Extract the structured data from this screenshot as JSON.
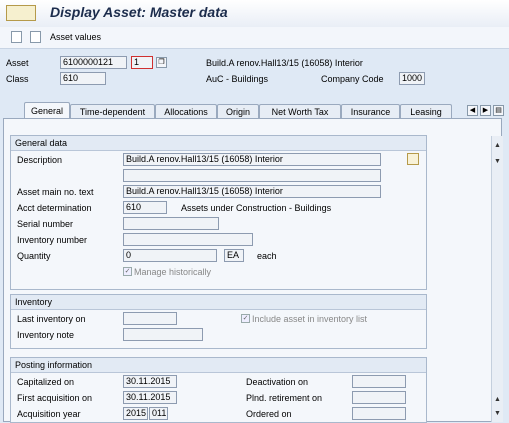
{
  "window": {
    "title": "Display Asset:  Master data"
  },
  "toolbar": {
    "asset_values_label": "Asset values"
  },
  "header": {
    "asset_label": "Asset",
    "asset_value": "6100000121",
    "sub_number": "1",
    "asset_desc": "Build.A renov.Hall13/15 (16058) Interior",
    "class_label": "Class",
    "class_value": "610",
    "class_desc": "AuC - Buildings",
    "company_code_label": "Company Code",
    "company_code_value": "1000"
  },
  "tabs": [
    "General",
    "Time-dependent",
    "Allocations",
    "Origin",
    "Net Worth Tax",
    "Insurance",
    "Leasing"
  ],
  "general_data": {
    "title": "General data",
    "description_label": "Description",
    "description_value": "Build.A renov.Hall13/15 (16058) Interior",
    "description_value2": "",
    "main_text_label": "Asset main no. text",
    "main_text_value": "Build.A renov.Hall13/15 (16058) Interior",
    "acct_det_label": "Acct determination",
    "acct_det_value": "610",
    "acct_det_desc": "Assets under Construction - Buildings",
    "serial_label": "Serial number",
    "inventory_number_label": "Inventory number",
    "quantity_label": "Quantity",
    "quantity_value": "0",
    "unit_value": "EA",
    "unit_desc": "each",
    "manage_hist_label": "Manage historically"
  },
  "inventory": {
    "title": "Inventory",
    "last_inventory_label": "Last inventory on",
    "include_label": "Include asset in inventory list",
    "note_label": "Inventory note"
  },
  "posting": {
    "title": "Posting information",
    "capitalized_label": "Capitalized on",
    "capitalized_value": "30.11.2015",
    "first_acq_label": "First acquisition on",
    "first_acq_value": "30.11.2015",
    "acq_year_label": "Acquisition year",
    "acq_year_value": "2015",
    "acq_period_value": "011",
    "deactivation_label": "Deactivation on",
    "planned_retirement_label": "Plnd. retirement on",
    "ordered_label": "Ordered on"
  }
}
